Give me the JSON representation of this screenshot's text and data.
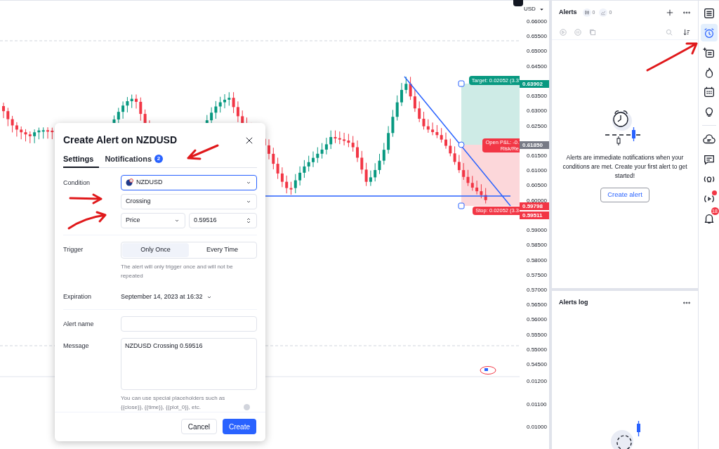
{
  "chart": {
    "currency": "USD",
    "price_axis": [
      "0.66000",
      "0.65500",
      "0.65000",
      "0.64500",
      "0.63500",
      "0.63000",
      "0.62500",
      "0.61500",
      "0.61000",
      "0.60500",
      "0.60000",
      "0.59000",
      "0.58500",
      "0.58000",
      "0.57500",
      "0.57000",
      "0.56500",
      "0.56000",
      "0.55500",
      "0.55000",
      "0.54500"
    ],
    "sub_axis": [
      "0.01200",
      "0.01100",
      "0.01000"
    ],
    "position": {
      "target_label": "Target: 0.02052 (3.3",
      "pnl_label": "Open P&L: -0.",
      "risk_label": "Risk/Re",
      "stop_label": "Stop: 0.02052 (3.3"
    },
    "price_tags": [
      {
        "kind": "target",
        "text": "0.63902"
      },
      {
        "kind": "entry",
        "text": "0.61850"
      },
      {
        "kind": "stop",
        "text": "0.59798"
      },
      {
        "kind": "last",
        "text": "0.59511"
      }
    ]
  },
  "dialog": {
    "title": "Create Alert on NZDUSD",
    "tabs": [
      {
        "label": "Settings",
        "selected": true
      },
      {
        "label": "Notifications",
        "selected": false,
        "count": "2"
      }
    ],
    "condition_label": "Condition",
    "symbol": "NZDUSD",
    "condition": "Crossing",
    "source": "Price",
    "value": "0.59516",
    "trigger_label": "Trigger",
    "trigger_options": [
      {
        "label": "Only Once",
        "selected": true
      },
      {
        "label": "Every Time",
        "selected": false
      }
    ],
    "trigger_note": "The alert will only trigger once and will not be repeated",
    "expiration_label": "Expiration",
    "expiration": "September 14, 2023 at 16:32",
    "name_label": "Alert name",
    "message_label": "Message",
    "message": "NZDUSD Crossing 0.59516",
    "hint": "You can use special placeholders such as {{close}}, {{time}}, {{plot_0}}, etc.",
    "buttons": [
      {
        "kind": "secondary",
        "label": "Cancel"
      },
      {
        "kind": "primary",
        "label": "Create"
      }
    ]
  },
  "alerts_panel": {
    "title": "Alerts",
    "counters": [
      "0",
      "0"
    ],
    "empty_text": "Alerts are immediate notifications when your conditions are met. Create your first alert to get started!",
    "create_button": "Create alert",
    "log_title": "Alerts log"
  },
  "toolbar": {
    "items": [
      {
        "kind": "list",
        "selected": false
      },
      {
        "kind": "alarm",
        "selected": true
      },
      {
        "kind": "list-plus",
        "selected": false
      },
      {
        "kind": "flame",
        "selected": false
      },
      {
        "kind": "calendar",
        "selected": false
      },
      {
        "kind": "bulb",
        "selected": false
      },
      {
        "kind": "cloud",
        "selected": false
      },
      {
        "kind": "chat",
        "selected": false
      },
      {
        "kind": "bulb-signal",
        "selected": false
      },
      {
        "kind": "stream",
        "selected": false,
        "dot": true
      },
      {
        "kind": "bell",
        "selected": false,
        "badge": "18"
      }
    ]
  }
}
